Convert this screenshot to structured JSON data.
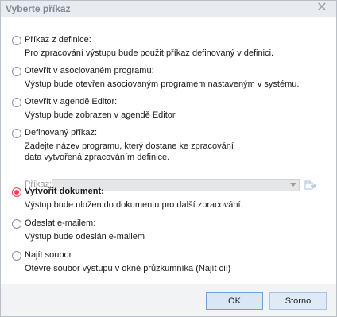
{
  "window": {
    "title": "Vyberte příkaz"
  },
  "options": [
    {
      "label": "Příkaz z definice:",
      "description": "Pro zpracování výstupu bude použit příkaz definovaný v definici.",
      "checked": false
    },
    {
      "label": "Otevřít v asociovaném programu:",
      "description": "Výstup bude otevřen asociovaným programem nastaveným v systému.",
      "checked": false
    },
    {
      "label": "Otevřít v agendě Editor:",
      "description": "Výstup bude zobrazen v agendě Editor.",
      "checked": false
    },
    {
      "label": "Definovaný příkaz:",
      "description_line1": "Zadejte název programu, který dostane ke zpracování",
      "description_line2": "data vytvořená zpracováním definice.",
      "checked": false
    },
    {
      "label": "Vytvořit dokument:",
      "description": "Výstup bude uložen do dokumentu pro další zpracování.",
      "checked": true
    },
    {
      "label": "Odeslat e-mailem:",
      "description": "Výstup bude odeslán e-mailem",
      "checked": false
    },
    {
      "label": "Najít soubor",
      "description": "Otevře soubor výstupu v okně průzkumníka (Najít cíl)",
      "checked": false
    }
  ],
  "command_field": {
    "label": "Příkaz:",
    "value": "",
    "disabled": true
  },
  "buttons": {
    "ok": "OK",
    "cancel": "Storno"
  },
  "colors": {
    "accent_radio": "#ff3d55",
    "titlebar": "#e8ebf0",
    "button": "#dfeaf6"
  },
  "icons": {
    "close": "close-icon",
    "browse": "browse-icon"
  }
}
